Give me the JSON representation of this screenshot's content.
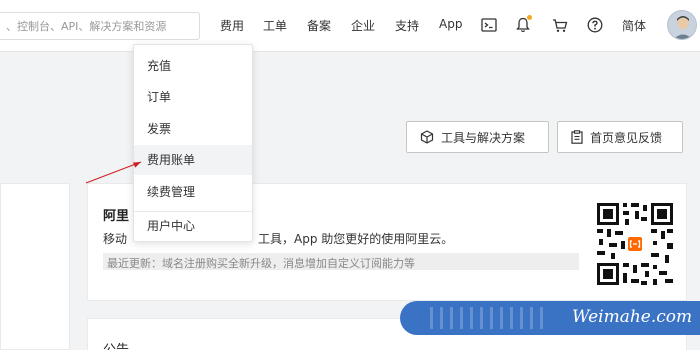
{
  "header": {
    "search_placeholder": "、控制台、API、解决方案和资源",
    "nav": [
      "费用",
      "工单",
      "备案",
      "企业",
      "支持",
      "App"
    ],
    "lang": "简体"
  },
  "dropdown": {
    "items": [
      {
        "label": "充值",
        "active": false
      },
      {
        "label": "订单",
        "active": false
      },
      {
        "label": "发票",
        "active": false
      },
      {
        "label": "费用账单",
        "active": true
      },
      {
        "label": "续费管理",
        "active": false
      },
      {
        "label": "用户中心",
        "active": false
      }
    ]
  },
  "toolbar": {
    "tools_label": "工具与解决方案",
    "feedback_label": "首页意见反馈"
  },
  "app_card": {
    "title": "阿里",
    "desc_a": "移动",
    "desc_b": "工具，App 助您更好的使用阿里云。",
    "update": "最近更新：域名注册购买全新升级，消息增加自定义订阅能力等"
  },
  "notice": {
    "title": "公告"
  },
  "watermark": {
    "text": "Weimahe.com"
  },
  "colors": {
    "accent": "#ff6a00",
    "arrow": "#cc1f1f",
    "watermark_bg": "#3a72c4"
  },
  "icons": [
    "terminal-icon",
    "bell-icon",
    "cart-icon",
    "help-icon",
    "cube-icon",
    "clipboard-icon",
    "qr-code"
  ]
}
